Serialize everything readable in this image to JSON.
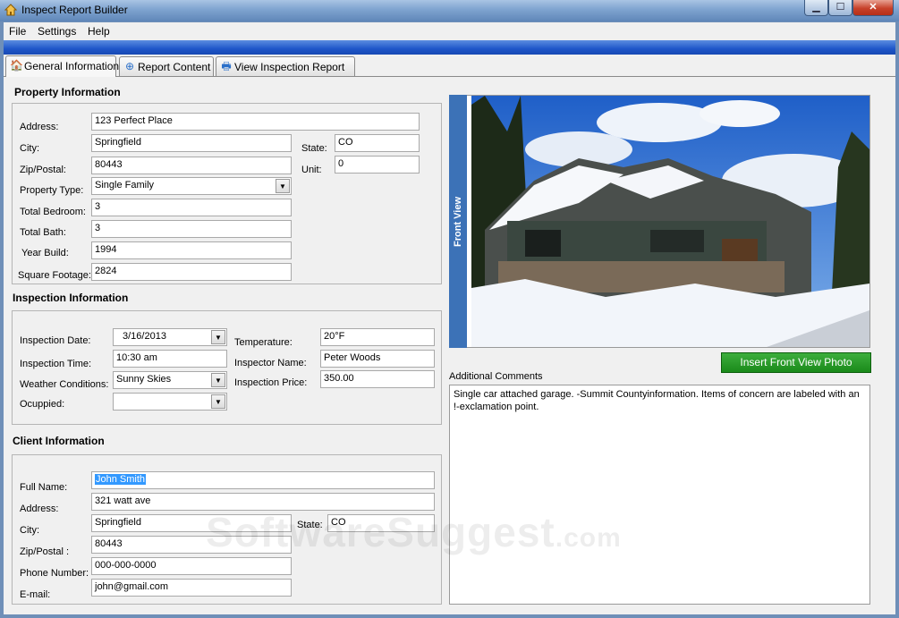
{
  "window": {
    "title": "Inspect Report Builder",
    "minimize_glyph": "▁",
    "maximize_glyph": "☐",
    "close_glyph": "✕"
  },
  "menu": {
    "file": "File",
    "settings": "Settings",
    "help": "Help"
  },
  "tabs": [
    {
      "label": "General Information",
      "icon": "house-icon"
    },
    {
      "label": "Report Content",
      "icon": "add-content-icon"
    },
    {
      "label": "View Inspection Report",
      "icon": "printer-icon"
    }
  ],
  "property": {
    "title": "Property Information",
    "address_label": "Address:",
    "address": "123 Perfect Place",
    "city_label": "City:",
    "city": "Springfield",
    "state_label": "State:",
    "state": "CO",
    "zip_label": "Zip/Postal:",
    "zip": "80443",
    "unit_label": "Unit:",
    "unit": "0",
    "type_label": "Property Type:",
    "type": "Single Family",
    "bedroom_label": "Total Bedroom:",
    "bedroom": "3",
    "bath_label": "Total Bath:",
    "bath": "3",
    "year_label": "Year Build:",
    "year": "1994",
    "sqft_label": "Square Footage:",
    "sqft": "2824"
  },
  "inspection": {
    "title": "Inspection Information",
    "date_label": "Inspection Date:",
    "date": "3/16/2013",
    "time_label": "Inspection Time:",
    "time": "10:30 am",
    "weather_label": "Weather Conditions:",
    "weather": "Sunny Skies",
    "occupied_label": "Ocuppied:",
    "occupied": "",
    "temperature_label": "Temperature:",
    "temperature": "20°F",
    "inspector_label": "Inspector Name:",
    "inspector": "Peter Woods",
    "price_label": "Inspection Price:",
    "price": "350.00"
  },
  "client": {
    "title": "Client Information",
    "name_label": "Full Name:",
    "name": "John Smith",
    "address_label": "Address:",
    "address": "321 watt ave",
    "city_label": "City:",
    "city": "Springfield",
    "state_label": "State:",
    "state": "CO",
    "zip_label": "Zip/Postal :",
    "zip": "80443",
    "phone_label": "Phone Number:",
    "phone": "000-000-0000",
    "email_label": "E-mail:",
    "email": "john@gmail.com"
  },
  "photo": {
    "side_label": "Front View",
    "insert_button": "Insert Front View Photo"
  },
  "comments": {
    "label": "Additional Comments",
    "text": "Single car attached garage. -Summit Countyinformation. Items of concern are labeled with an !-exclamation point."
  },
  "watermark": {
    "main": "SoftwareSuggest",
    "suffix": ".com"
  },
  "colors": {
    "accent_blue": "#3c72b7",
    "insert_green": "#1a8a1a",
    "menu_strip": "#1f56c9"
  }
}
